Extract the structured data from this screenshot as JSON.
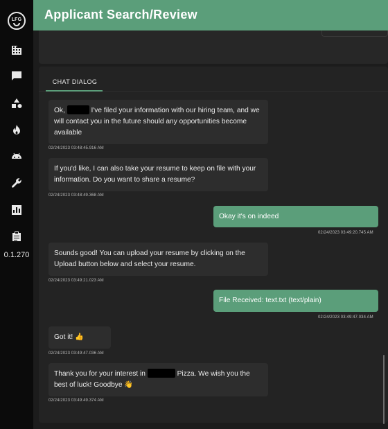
{
  "app": {
    "logo_text": "LFG",
    "version": "0.1.270",
    "title": "Applicant Search/Review"
  },
  "sidebar": {
    "items": [
      {
        "icon": "building-icon"
      },
      {
        "icon": "chat-icon"
      },
      {
        "icon": "shapes-icon"
      },
      {
        "icon": "fire-icon"
      },
      {
        "icon": "android-icon"
      },
      {
        "icon": "wrench-icon"
      },
      {
        "icon": "chart-icon"
      },
      {
        "icon": "clipboard-icon"
      }
    ]
  },
  "chat": {
    "tab_label": "CHAT DIALOG",
    "messages": [
      {
        "sender": "bot",
        "text_before": "Ok, ",
        "text_after": " I've filed your information with our hiring team, and we will contact you in the future should any opportunities become available",
        "timestamp": "02/24/2023 03:48:45.916 AM"
      },
      {
        "sender": "bot",
        "text": "If you'd like, I can also take your resume to keep on file with your information. Do you want to share a resume?",
        "timestamp": "02/24/2023 03:48:49.368 AM"
      },
      {
        "sender": "user",
        "text": "Okay it's on indeed",
        "timestamp": "02/24/2023 03:49:20.745 AM"
      },
      {
        "sender": "bot",
        "text": "Sounds good! You can upload your resume by clicking on the Upload button below and select your resume.",
        "timestamp": "02/24/2023 03:49:21.023 AM"
      },
      {
        "sender": "user",
        "text": "File Received: text.txt (text/plain)",
        "timestamp": "02/24/2023 03:49:47.034 AM"
      },
      {
        "sender": "bot",
        "text": "Got it! 👍",
        "timestamp": "02/24/2023 03:49:47.036 AM"
      },
      {
        "sender": "bot",
        "text_before": "Thank you for your interest in ",
        "text_after": " Pizza. We wish you the best of luck! Goodbye 👋",
        "timestamp": "02/24/2023 03:49:49.374 AM"
      }
    ]
  },
  "colors": {
    "accent": "#5b9e7a",
    "sidebar_bg": "#0b0b0b",
    "page_bg": "#1c1c1c",
    "bubble_bot": "#2d2d2d"
  }
}
